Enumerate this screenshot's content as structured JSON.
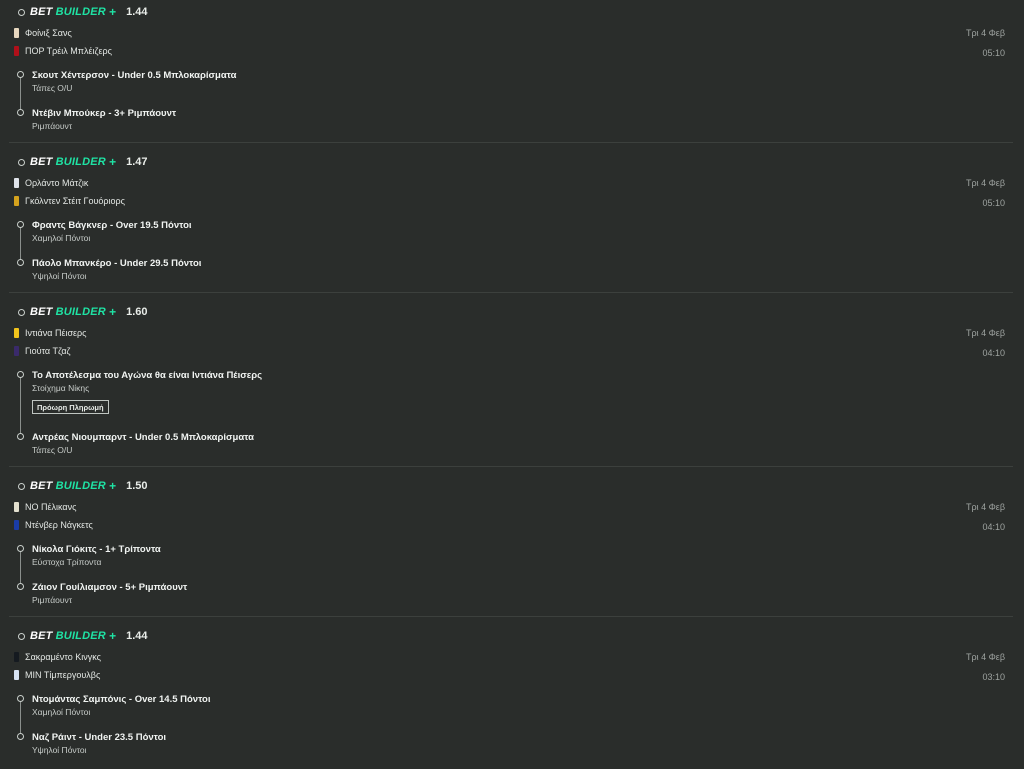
{
  "brand": {
    "bet": "BET",
    "builder": "BUILDER",
    "plus": "+"
  },
  "colors": {
    "background": "#2a2d2b",
    "accent": "#1fe3a4",
    "divider": "#3c403d"
  },
  "bets": [
    {
      "odds": "1.44",
      "home": {
        "name": "Φοίνιξ Σανς",
        "jersey_color": "#e7d7bf",
        "jersey_icon": "jersey-icon"
      },
      "away": {
        "name": "ΠΟΡ Τρέιλ Μπλέιζερς",
        "jersey_color": "#b0101a",
        "jersey_icon": "jersey-icon"
      },
      "date": "Τρι 4 Φεβ",
      "time": "05:10",
      "legs": [
        {
          "title": "Σκουτ Χέντερσον - Under 0.5 Μπλοκαρίσματα",
          "market": "Τάπες O/U"
        },
        {
          "title": "Ντέβιν Μπούκερ - 3+ Ριμπάουντ",
          "market": "Ριμπάουντ"
        }
      ]
    },
    {
      "odds": "1.47",
      "home": {
        "name": "Ορλάντο Μάτζικ",
        "jersey_color": "#dfe3ea",
        "jersey_icon": "jersey-icon"
      },
      "away": {
        "name": "Γκόλντεν Στέιτ Γουόριορς",
        "jersey_color": "#d4a21d",
        "jersey_icon": "jersey-icon"
      },
      "date": "Τρι 4 Φεβ",
      "time": "05:10",
      "legs": [
        {
          "title": "Φραντς Βάγκνερ - Over 19.5 Πόντοι",
          "market": "Χαμηλοί Πόντοι"
        },
        {
          "title": "Πάολο Μπανκέρο - Under 29.5 Πόντοι",
          "market": "Υψηλοί Πόντοι"
        }
      ]
    },
    {
      "odds": "1.60",
      "home": {
        "name": "Ιντιάνα Πέισερς",
        "jersey_color": "#f2c41c",
        "jersey_icon": "jersey-icon"
      },
      "away": {
        "name": "Γιούτα Τζαζ",
        "jersey_color": "#3a2a6b",
        "jersey_icon": "jersey-icon"
      },
      "date": "Τρι 4 Φεβ",
      "time": "04:10",
      "legs": [
        {
          "title": "Το Αποτέλεσμα του Αγώνα θα είναι Ιντιάνα Πέισερς",
          "market": "Στοίχημα Νίκης",
          "badge": "Πρόωρη Πληρωμή"
        },
        {
          "title": "Αντρέας Νιουμπαρντ - Under 0.5 Μπλοκαρίσματα",
          "market": "Τάπες O/U"
        }
      ]
    },
    {
      "odds": "1.50",
      "home": {
        "name": "ΝΟ Πέλικανς",
        "jersey_color": "#e3e0cf",
        "jersey_icon": "jersey-icon"
      },
      "away": {
        "name": "Ντένβερ Νάγκετς",
        "jersey_color": "#1a3ca8",
        "jersey_icon": "jersey-icon"
      },
      "date": "Τρι 4 Φεβ",
      "time": "04:10",
      "legs": [
        {
          "title": "Νίκολα Γιόκιτς - 1+ Τρίποντα",
          "market": "Εύστοχα Τρίποντα"
        },
        {
          "title": "Ζάιον Γουίλιαμσον - 5+ Ριμπάουντ",
          "market": "Ριμπάουντ"
        }
      ]
    },
    {
      "odds": "1.44",
      "home": {
        "name": "Σακραμέντο Κινγκς",
        "jersey_color": "#151a20",
        "jersey_icon": "jersey-icon"
      },
      "away": {
        "name": "ΜΙΝ Τίμπεργουλβς",
        "jersey_color": "#d6e2f2",
        "jersey_icon": "jersey-icon"
      },
      "date": "Τρι 4 Φεβ",
      "time": "03:10",
      "legs": [
        {
          "title": "Ντομάντας Σαμπόνις - Over 14.5 Πόντοι",
          "market": "Χαμηλοί Πόντοι"
        },
        {
          "title": "Ναζ Ράιντ - Under 23.5 Πόντοι",
          "market": "Υψηλοί Πόντοι"
        }
      ]
    }
  ]
}
